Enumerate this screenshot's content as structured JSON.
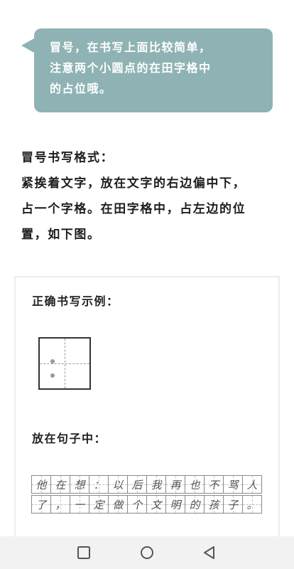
{
  "bubble": {
    "lines": [
      "冒号，在书写上面比较简单，",
      "注意两个小圆点的在田字格中",
      "的占位哦。"
    ]
  },
  "description": {
    "title": "冒号书写格式：",
    "lines": [
      "紧挨着文字，放在文字的右边偏中下，",
      "占一个字格。在田字格中，占左边的位",
      "置，如下图。"
    ]
  },
  "example_card": {
    "heading": "正确书写示例：",
    "sentence_heading": "放在句子中：",
    "grid_rows": [
      [
        "他",
        "在",
        "想",
        "：",
        "以",
        "后",
        "我",
        "再",
        "也",
        "不",
        "骂",
        "人"
      ],
      [
        "了",
        "，",
        "一",
        "定",
        "做",
        "个",
        "文",
        "明",
        "的",
        "孩",
        "子",
        "。"
      ]
    ]
  },
  "navbar": {
    "icons": [
      "recent-apps-square-icon",
      "home-circle-icon",
      "back-triangle-icon"
    ]
  },
  "colors": {
    "bubble": "#8fb3b5",
    "navbar": "#f2f2f2"
  }
}
